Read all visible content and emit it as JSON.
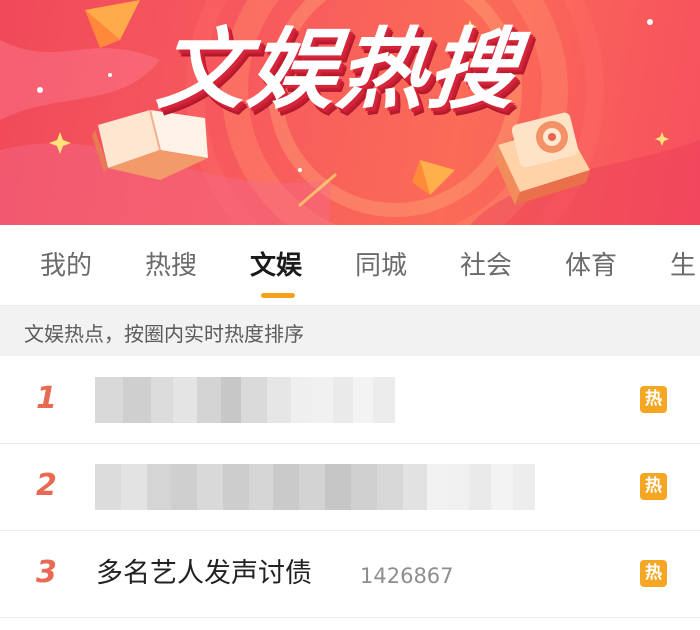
{
  "banner": {
    "title": "文娱热搜"
  },
  "tabs": [
    {
      "label": "我的",
      "active": false
    },
    {
      "label": "热搜",
      "active": false
    },
    {
      "label": "文娱",
      "active": true
    },
    {
      "label": "同城",
      "active": false
    },
    {
      "label": "社会",
      "active": false
    },
    {
      "label": "体育",
      "active": false
    },
    {
      "label": "生",
      "active": false
    }
  ],
  "description": "文娱热点，按圈内实时热度排序",
  "list": [
    {
      "rank": "1",
      "title": "",
      "count": "",
      "badge": "热",
      "blurred": true
    },
    {
      "rank": "2",
      "title": "",
      "count": "",
      "badge": "热",
      "blurred": true
    },
    {
      "rank": "3",
      "title": "多名艺人发声讨债",
      "count": "1426867",
      "badge": "热",
      "blurred": false
    }
  ],
  "colors": {
    "accent": "#f7a11a",
    "rank": "#e86a52",
    "badge": "#f5a623",
    "banner_start": "#f0495a",
    "banner_end": "#fb6b57"
  },
  "icons": [
    "open-book-icon",
    "camera-icon",
    "sparkle-icon"
  ]
}
